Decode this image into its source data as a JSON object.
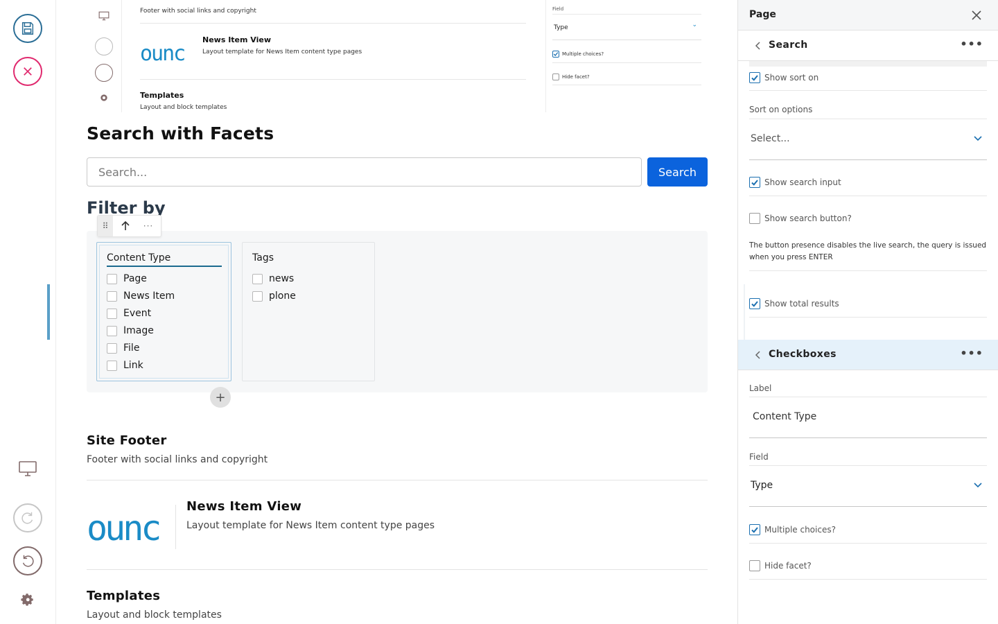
{
  "toolbar": {
    "save_icon": "save-icon",
    "cancel_icon": "close-circle-icon"
  },
  "preview": {
    "footer_desc": "Footer with social links and copyright",
    "news_title": "News Item View",
    "news_desc": "Layout template for News Item content type pages",
    "templates_title": "Templates",
    "templates_desc": "Layout and block templates",
    "field_label": "Field",
    "field_value": "Type",
    "multiple_choices": "Multiple choices?",
    "hide_facet": "Hide facet?"
  },
  "main": {
    "title": "Search with Facets",
    "search_placeholder": "Search...",
    "search_button": "Search",
    "filter_title": "Filter by",
    "facets": [
      {
        "label": "Content Type",
        "options": [
          "Page",
          "News Item",
          "Event",
          "Image",
          "File",
          "Link"
        ]
      },
      {
        "label": "Tags",
        "options": [
          "news",
          "plone"
        ]
      }
    ],
    "sections": {
      "footer_title": "Site Footer",
      "footer_desc": "Footer with social links and copyright",
      "news_title": "News Item View",
      "news_desc": "Layout template for News Item content type pages",
      "templates_title": "Templates",
      "templates_desc": "Layout and block templates"
    },
    "logo_text": "ounc"
  },
  "sidebar": {
    "header": "Page",
    "search_section": "Search",
    "show_sort_on": "Show sort on",
    "sort_on_options_label": "Sort on options",
    "sort_on_placeholder": "Select...",
    "show_search_input": "Show search input",
    "show_search_button": "Show search button?",
    "search_button_help": "The button presence disables the live search, the query is issued when you press ENTER",
    "show_total_results": "Show total results",
    "checkboxes_section": "Checkboxes",
    "label_label": "Label",
    "label_value": "Content Type",
    "field_label": "Field",
    "field_value": "Type",
    "multiple_choices": "Multiple choices?",
    "hide_facet": "Hide facet?"
  },
  "colors": {
    "primary_button": "#0b63dd",
    "accent_blue": "#1a6fb0",
    "cancel_pink": "#e0296e",
    "selected_section_bg": "#e5f1fa"
  }
}
